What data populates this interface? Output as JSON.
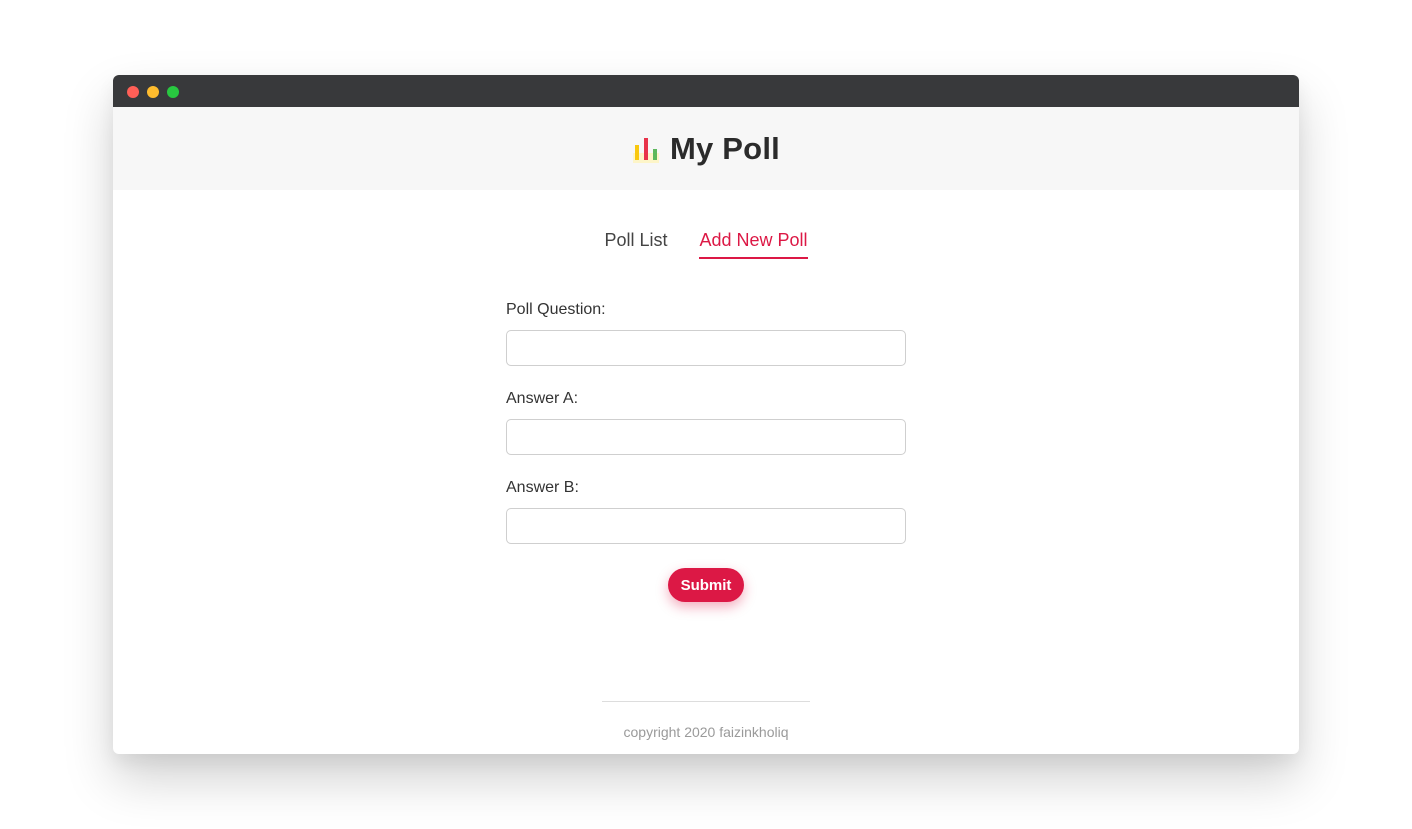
{
  "window": {
    "controls": [
      {
        "name": "close",
        "color": "#ff5f57"
      },
      {
        "name": "minimize",
        "color": "#febc2e"
      },
      {
        "name": "zoom",
        "color": "#28c840"
      }
    ]
  },
  "header": {
    "icon": "bar-chart-icon",
    "title": "My Poll"
  },
  "tabs": [
    {
      "label": "Poll List",
      "active": false
    },
    {
      "label": "Add New Poll",
      "active": true
    }
  ],
  "form": {
    "question": {
      "label": "Poll Question:",
      "value": "",
      "placeholder": ""
    },
    "answer_a": {
      "label": "Answer A:",
      "value": "",
      "placeholder": ""
    },
    "answer_b": {
      "label": "Answer B:",
      "value": "",
      "placeholder": ""
    },
    "submit_label": "Submit"
  },
  "footer": {
    "text": "copyright 2020 faizinkholiq"
  },
  "colors": {
    "accent": "#dc1845",
    "header_bg": "#f7f7f7",
    "titlebar_bg": "#38393b",
    "tab_active_text": "#dc1845",
    "tab_text": "#444444"
  }
}
